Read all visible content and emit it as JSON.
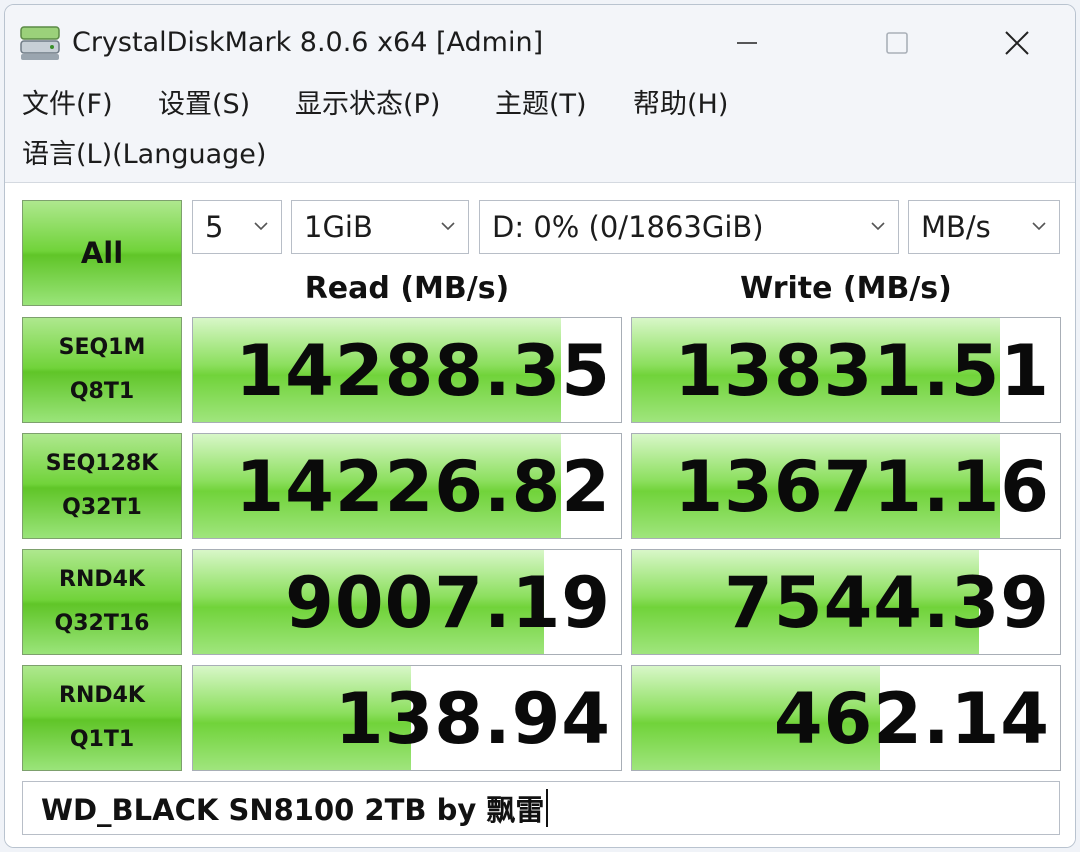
{
  "window": {
    "title": "CrystalDiskMark 8.0.6 x64 [Admin]"
  },
  "icons": {
    "app": "disk-icon",
    "minimize": "minimize-icon",
    "maximize": "maximize-icon",
    "close": "close-icon",
    "dropdown": "chevron-down-icon"
  },
  "menu": {
    "file": "文件(F)",
    "settings": "设置(S)",
    "display": "显示状态(P)",
    "theme": "主题(T)",
    "help": "帮助(H)",
    "language": "语言(L)(Language)"
  },
  "controls": {
    "all_button": "All",
    "count": "5",
    "size": "1GiB",
    "drive": "D: 0% (0/1863GiB)",
    "unit": "MB/s"
  },
  "headers": {
    "read": "Read (MB/s)",
    "write": "Write (MB/s)"
  },
  "tests": [
    {
      "line1": "SEQ1M",
      "line2": "Q8T1",
      "read": "14288.35",
      "write": "13831.51",
      "read_fill": 0.86,
      "write_fill": 0.86
    },
    {
      "line1": "SEQ128K",
      "line2": "Q32T1",
      "read": "14226.82",
      "write": "13671.16",
      "read_fill": 0.86,
      "write_fill": 0.86
    },
    {
      "line1": "RND4K",
      "line2": "Q32T16",
      "read": "9007.19",
      "write": "7544.39",
      "read_fill": 0.82,
      "write_fill": 0.81
    },
    {
      "line1": "RND4K",
      "line2": "Q1T1",
      "read": "138.94",
      "write": "462.14",
      "read_fill": 0.51,
      "write_fill": 0.58
    }
  ],
  "comment": "WD_BLACK SN8100 2TB by 飘雷",
  "colors": {
    "accent_green": "#71d33a",
    "button_border": "#7da06d"
  }
}
